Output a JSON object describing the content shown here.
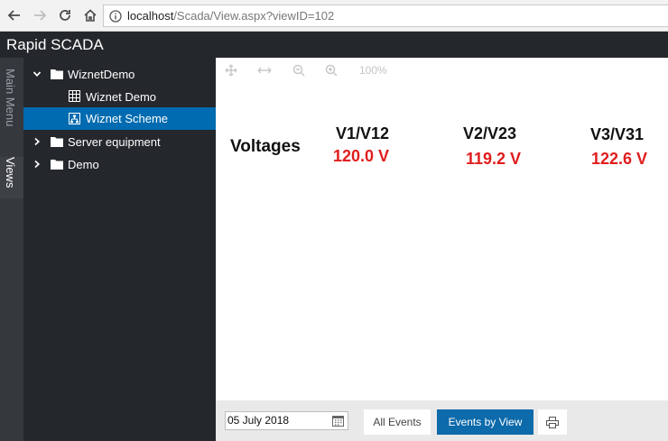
{
  "browser": {
    "url_host": "localhost",
    "url_path": "/Scada/View.aspx?viewID=102"
  },
  "app": {
    "title": "Rapid SCADA"
  },
  "side_tabs": {
    "main_menu": "Main Menu",
    "views": "Views"
  },
  "tree": {
    "items": [
      {
        "label": "WiznetDemo",
        "expanded": true,
        "selected": false
      },
      {
        "label": "Wiznet Demo",
        "selected": false
      },
      {
        "label": "Wiznet Scheme",
        "selected": true
      },
      {
        "label": "Server equipment",
        "expanded": false,
        "selected": false
      },
      {
        "label": "Demo",
        "expanded": false,
        "selected": false
      }
    ]
  },
  "scheme": {
    "zoom": "100%",
    "title": "Voltages",
    "channels": [
      {
        "name": "V1/V12",
        "value": "120.0 V"
      },
      {
        "name": "V2/V23",
        "value": "119.2 V"
      },
      {
        "name": "V3/V31",
        "value": "122.6 V"
      }
    ],
    "value_color": "#e11d1d"
  },
  "events_bar": {
    "date": "05 July 2018",
    "all_events": "All Events",
    "events_by_view": "Events by View",
    "active_color": "#0d6aab"
  }
}
